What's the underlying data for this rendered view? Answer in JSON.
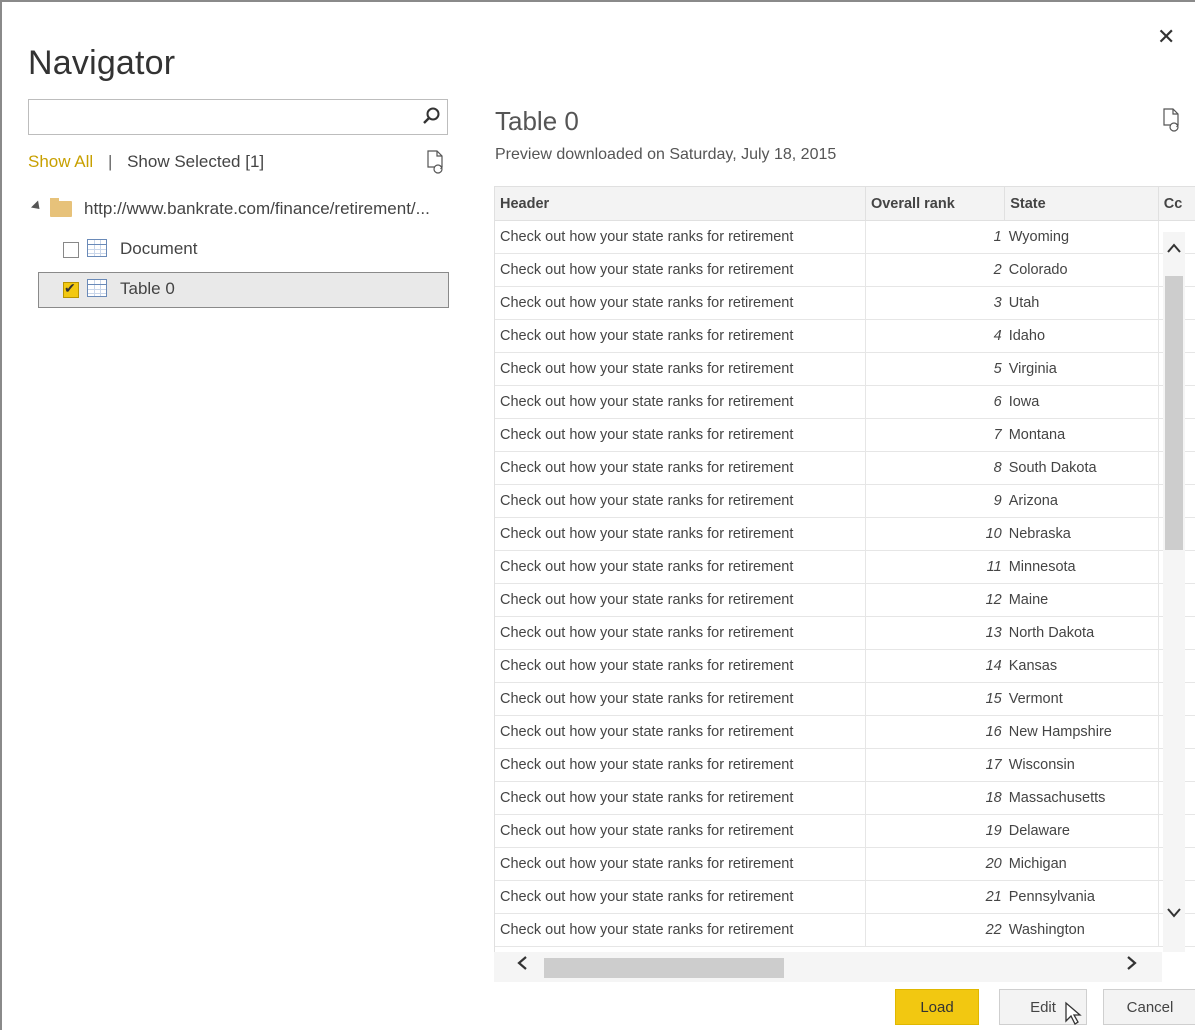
{
  "window": {
    "title": "Navigator",
    "close_label": "✕"
  },
  "left": {
    "search_value": "",
    "show_all": "Show All",
    "separator": "|",
    "show_selected": "Show Selected [1]",
    "tree": {
      "root_url": "http://www.bankrate.com/finance/retirement/...",
      "items": [
        {
          "label": "Document",
          "checked": false
        },
        {
          "label": "Table 0",
          "checked": true
        }
      ]
    }
  },
  "preview": {
    "title": "Table 0",
    "subtitle": "Preview downloaded on Saturday, July 18, 2015",
    "columns": [
      "Header",
      "Overall rank",
      "State",
      "Cc"
    ],
    "rows": [
      [
        "Check out how your state ranks for retirement",
        "1",
        "Wyoming"
      ],
      [
        "Check out how your state ranks for retirement",
        "2",
        "Colorado"
      ],
      [
        "Check out how your state ranks for retirement",
        "3",
        "Utah"
      ],
      [
        "Check out how your state ranks for retirement",
        "4",
        "Idaho"
      ],
      [
        "Check out how your state ranks for retirement",
        "5",
        "Virginia"
      ],
      [
        "Check out how your state ranks for retirement",
        "6",
        "Iowa"
      ],
      [
        "Check out how your state ranks for retirement",
        "7",
        "Montana"
      ],
      [
        "Check out how your state ranks for retirement",
        "8",
        "South Dakota"
      ],
      [
        "Check out how your state ranks for retirement",
        "9",
        "Arizona"
      ],
      [
        "Check out how your state ranks for retirement",
        "10",
        "Nebraska"
      ],
      [
        "Check out how your state ranks for retirement",
        "11",
        "Minnesota"
      ],
      [
        "Check out how your state ranks for retirement",
        "12",
        "Maine"
      ],
      [
        "Check out how your state ranks for retirement",
        "13",
        "North Dakota"
      ],
      [
        "Check out how your state ranks for retirement",
        "14",
        "Kansas"
      ],
      [
        "Check out how your state ranks for retirement",
        "15",
        "Vermont"
      ],
      [
        "Check out how your state ranks for retirement",
        "16",
        "New Hampshire"
      ],
      [
        "Check out how your state ranks for retirement",
        "17",
        "Wisconsin"
      ],
      [
        "Check out how your state ranks for retirement",
        "18",
        "Massachusetts"
      ],
      [
        "Check out how your state ranks for retirement",
        "19",
        "Delaware"
      ],
      [
        "Check out how your state ranks for retirement",
        "20",
        "Michigan"
      ],
      [
        "Check out how your state ranks for retirement",
        "21",
        "Pennsylvania"
      ],
      [
        "Check out how your state ranks for retirement",
        "22",
        "Washington"
      ]
    ]
  },
  "buttons": {
    "load": "Load",
    "edit": "Edit",
    "cancel": "Cancel"
  },
  "colors": {
    "accent": "#f2c811",
    "show_all": "#c8a000",
    "folder": "#e7c27a"
  },
  "icons": {
    "search": "search-icon",
    "refresh": "refresh-icon",
    "folder": "folder-icon",
    "table": "table-icon",
    "close": "close-icon",
    "cursor": "mouse-pointer-icon"
  }
}
